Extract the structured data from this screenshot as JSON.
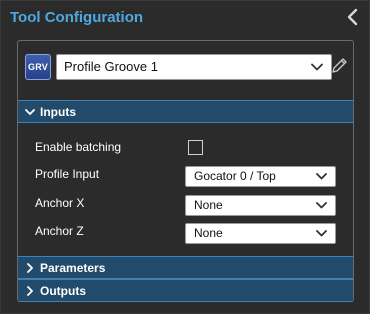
{
  "panel": {
    "title": "Tool Configuration"
  },
  "tool": {
    "icon_text": "GRV",
    "selected_name": "Profile Groove 1"
  },
  "sections": {
    "inputs": {
      "label": "Inputs",
      "expanded": true
    },
    "parameters": {
      "label": "Parameters",
      "expanded": false
    },
    "outputs": {
      "label": "Outputs",
      "expanded": false
    }
  },
  "inputs": {
    "enable_batching": {
      "label": "Enable batching",
      "checked": false
    },
    "profile_input": {
      "label": "Profile Input",
      "value": "Gocator 0 / Top"
    },
    "anchor_x": {
      "label": "Anchor X",
      "value": "None"
    },
    "anchor_z": {
      "label": "Anchor Z",
      "value": "None"
    }
  },
  "colors": {
    "accent": "#4fa8e0",
    "section_header": "#214a6b",
    "background": "#2b2b2b"
  },
  "icons": [
    "chevron-left-icon",
    "chevron-down-icon",
    "pencil-icon",
    "chevron-right-icon",
    "checkbox-icon"
  ]
}
